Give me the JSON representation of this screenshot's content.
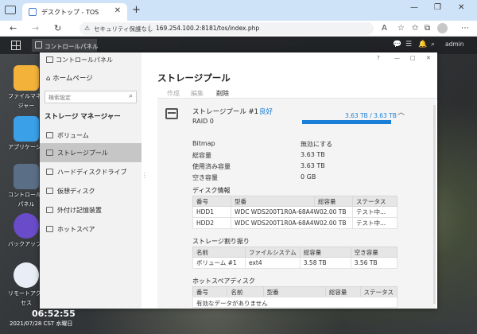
{
  "browser": {
    "tab_title": "デスクトップ - TOS",
    "new_tab": "+",
    "minimize": "—",
    "restore": "❐",
    "close": "✕",
    "tab_close": "✕",
    "security_warning": "セキュリティ保護なし",
    "url": "169.254.100.2:8181/tos/index.php"
  },
  "tos": {
    "taskbar_app_label": "コントロールパネル",
    "user": "admin"
  },
  "desktop": {
    "icons": [
      {
        "label": "ファイルマネー",
        "label2": "ジャー",
        "color": "#f3b23a"
      },
      {
        "label": "アプリケーション",
        "label2": "",
        "color": "#3aa0e8"
      },
      {
        "label": "コントロール",
        "label2": "パネル",
        "color": "#5a6e86"
      },
      {
        "label": "バックアップ",
        "label2": "",
        "color": "#6a4bc9"
      },
      {
        "label": "リモートアク",
        "label2": "セス",
        "color": "#e9eef6"
      }
    ],
    "clock": "06:52:55",
    "date": "2021/07/28 CST 水曜日"
  },
  "window": {
    "title": "コントロールパネル",
    "controls": [
      "?",
      "—",
      "□",
      "✕"
    ],
    "home": "ホームページ",
    "search_placeholder": "検索設定",
    "section": "ストレージ マネージャー",
    "nav": [
      {
        "label": "ボリューム",
        "active": false
      },
      {
        "label": "ストレージプール",
        "active": true
      },
      {
        "label": "ハードディスクドライブ",
        "active": false
      },
      {
        "label": "仮想ディスク",
        "active": false
      },
      {
        "label": "外付け記憶装置",
        "active": false
      },
      {
        "label": "ホットスペア",
        "active": false
      }
    ]
  },
  "main": {
    "title": "ストレージプール",
    "toolbar": {
      "create": "作成",
      "edit": "編集",
      "delete": "削除"
    },
    "pool": {
      "name": "ストレージプール #1",
      "status": "良好",
      "raid": "RAID 0",
      "capacity_text": "3.63 TB / 3.63 TB",
      "usage_percent": 100,
      "details": [
        {
          "k": "Bitmap",
          "v": "無効にする"
        },
        {
          "k": "総容量",
          "v": "3.63 TB"
        },
        {
          "k": "使用済み容量",
          "v": "3.63 TB"
        },
        {
          "k": "空き容量",
          "v": "0 GB"
        }
      ],
      "disk_info_title": "ディスク情報",
      "disk_headers": [
        "番号",
        "型番",
        "総容量",
        "ステータス"
      ],
      "disks": [
        [
          "HDD1",
          "WDC WDS200T1R0A-68A4W02.00 TB",
          "",
          "テスト中..."
        ],
        [
          "HDD2",
          "WDC WDS200T1R0A-68A4W02.00 TB",
          "",
          "テスト中..."
        ]
      ],
      "alloc_title": "ストレージ割り振り",
      "alloc_headers": [
        "名前",
        "ファイルシステム",
        "総容量",
        "空き容量"
      ],
      "alloc": [
        [
          "ボリューム #1",
          "ext4",
          "3.58 TB",
          "3.56 TB"
        ]
      ],
      "hotspare_title": "ホットスペアディスク",
      "hotspare_headers": [
        "番号",
        "名前",
        "型番",
        "総容量",
        "ステータス"
      ],
      "hotspare_empty": "有効なデータがありません"
    }
  }
}
